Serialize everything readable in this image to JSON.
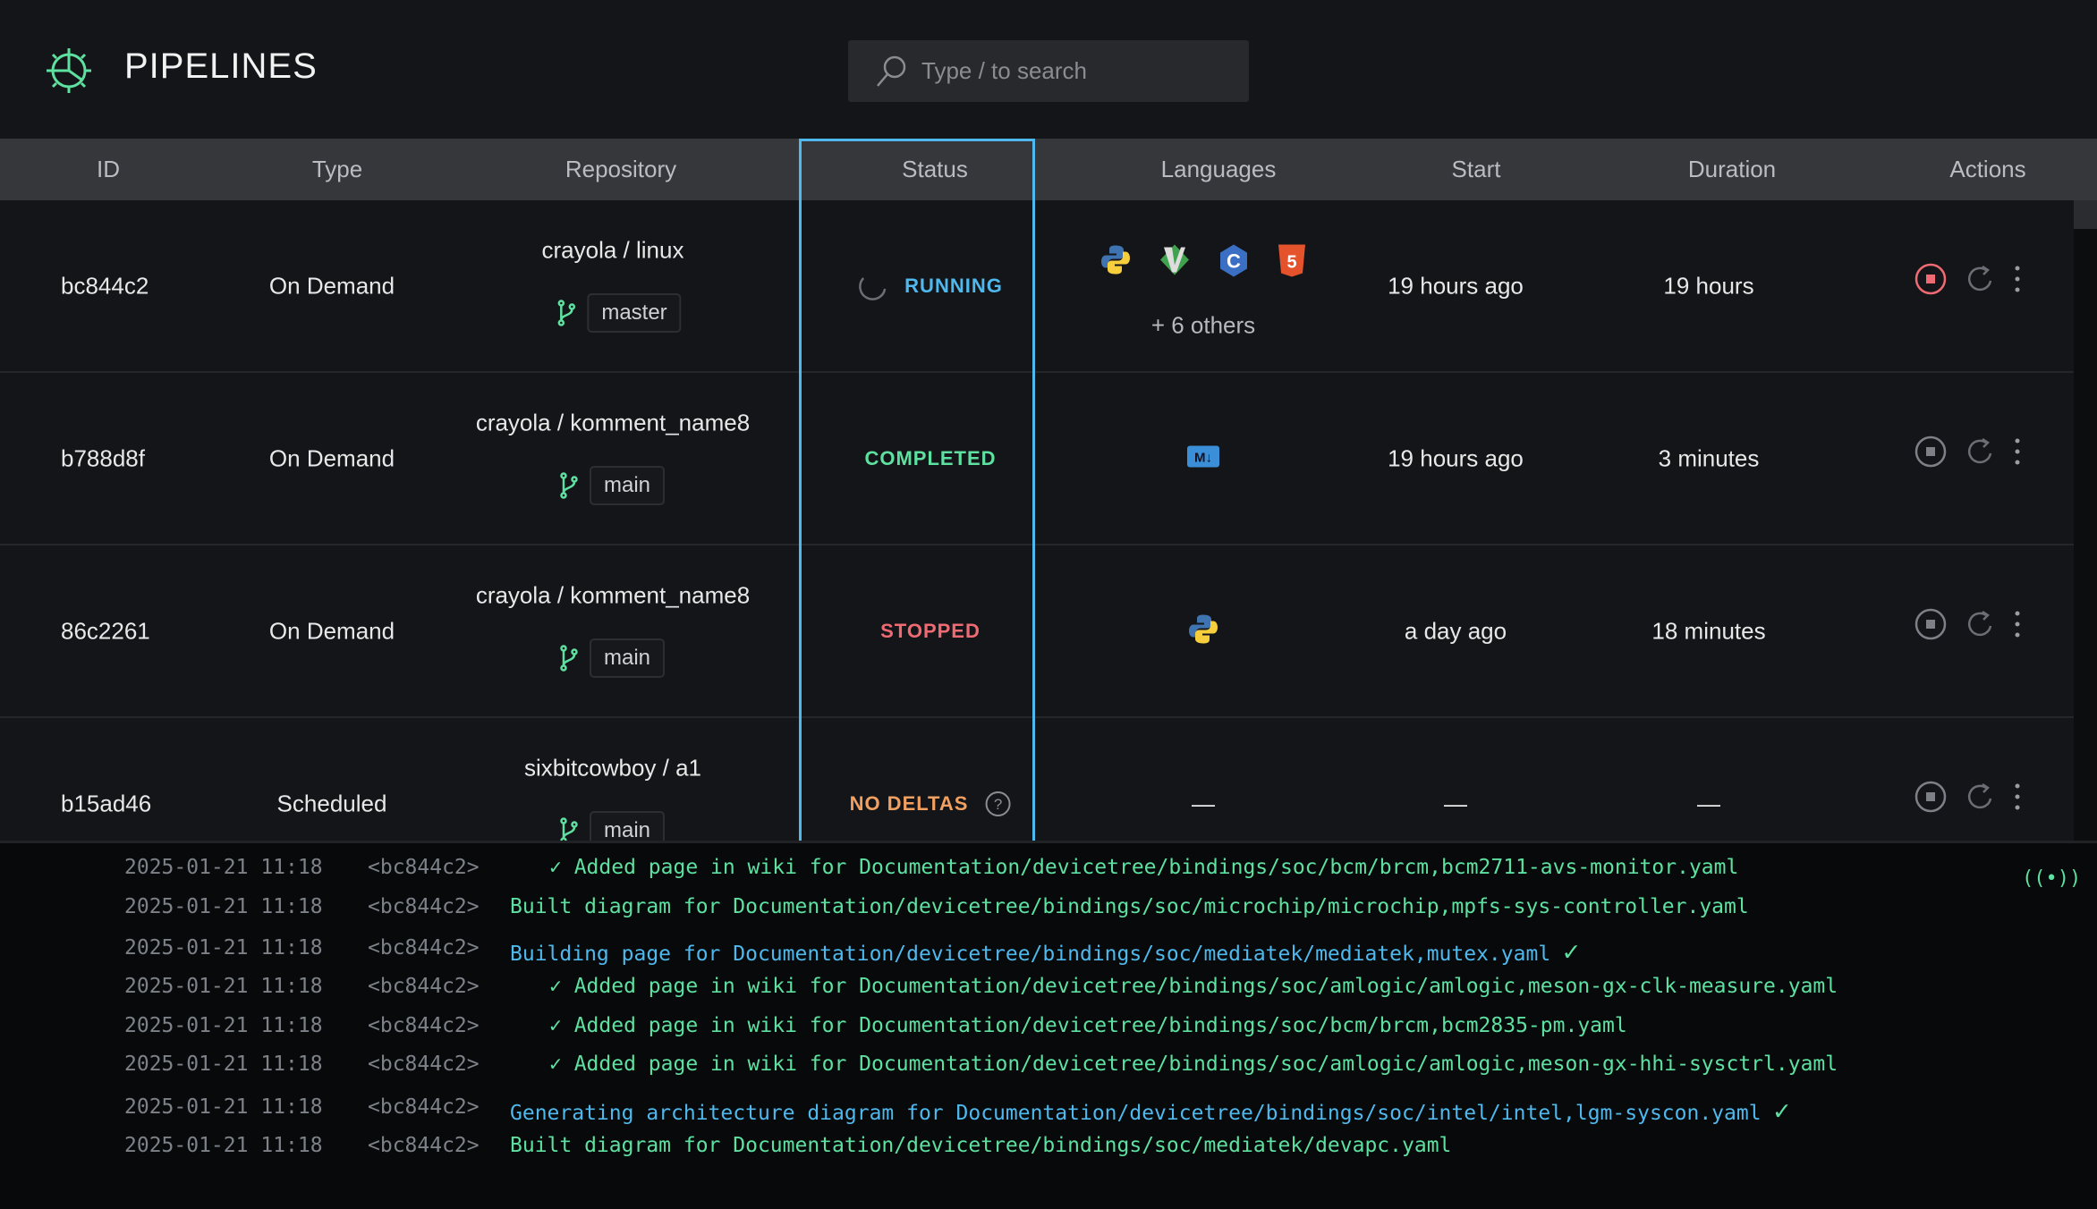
{
  "app": {
    "title": "PIPELINES",
    "search_placeholder": "Type / to search"
  },
  "colors": {
    "accent": "#5ee0a0",
    "running": "#4fb8ec",
    "completed": "#5ee0a0",
    "stopped": "#ef6b73",
    "no_deltas": "#f0a060",
    "highlight": "#4fb8ec"
  },
  "columns": [
    "ID",
    "Type",
    "Repository",
    "Status",
    "Languages",
    "Start",
    "Duration",
    "Actions"
  ],
  "rows": [
    {
      "id": "bc844c2",
      "type": "On Demand",
      "repo": "crayola / linux",
      "branch": "master",
      "status": "RUNNING",
      "languages": [
        "python",
        "vim",
        "c",
        "html5"
      ],
      "others": "+ 6 others",
      "start": "19 hours ago",
      "duration": "19 hours",
      "stop_active": true
    },
    {
      "id": "b788d8f",
      "type": "On Demand",
      "repo": "crayola / komment_name8",
      "branch": "main",
      "status": "COMPLETED",
      "languages": [
        "markdown"
      ],
      "start": "19 hours ago",
      "duration": "3 minutes",
      "stop_active": false
    },
    {
      "id": "86c2261",
      "type": "On Demand",
      "repo": "crayola / komment_name8",
      "branch": "main",
      "status": "STOPPED",
      "languages": [
        "python"
      ],
      "start": "a day ago",
      "duration": "18 minutes",
      "stop_active": false
    },
    {
      "id": "b15ad46",
      "type": "Scheduled",
      "repo": "sixbitcowboy / a1",
      "branch": "main",
      "status": "NO DELTAS",
      "languages": "—",
      "start": "—",
      "duration": "—",
      "stop_active": false
    }
  ],
  "logs": [
    {
      "ts": "2025-01-21 11:18",
      "id": "<bc844c2>",
      "kind": "added",
      "msg": "✓ Added page in wiki for Documentation/devicetree/bindings/soc/bcm/brcm,bcm2711-avs-monitor.yaml"
    },
    {
      "ts": "2025-01-21 11:18",
      "id": "<bc844c2>",
      "kind": "built",
      "msg": "Built diagram for Documentation/devicetree/bindings/soc/microchip/microchip,mpfs-sys-controller.yaml"
    },
    {
      "ts": "2025-01-21 11:18",
      "id": "<bc844c2>",
      "kind": "progress",
      "msg": "Building page for Documentation/devicetree/bindings/soc/mediatek/mediatek,mutex.yaml",
      "tick": "✓"
    },
    {
      "ts": "2025-01-21 11:18",
      "id": "<bc844c2>",
      "kind": "added",
      "msg": "✓ Added page in wiki for Documentation/devicetree/bindings/soc/amlogic/amlogic,meson-gx-clk-measure.yaml"
    },
    {
      "ts": "2025-01-21 11:18",
      "id": "<bc844c2>",
      "kind": "added",
      "msg": "✓ Added page in wiki for Documentation/devicetree/bindings/soc/bcm/brcm,bcm2835-pm.yaml"
    },
    {
      "ts": "2025-01-21 11:18",
      "id": "<bc844c2>",
      "kind": "added",
      "msg": "✓ Added page in wiki for Documentation/devicetree/bindings/soc/amlogic/amlogic,meson-gx-hhi-sysctrl.yaml"
    },
    {
      "ts": "2025-01-21 11:18",
      "id": "<bc844c2>",
      "kind": "progress",
      "msg": "Generating architecture diagram for Documentation/devicetree/bindings/soc/intel/intel,lgm-syscon.yaml",
      "tick": "✓"
    },
    {
      "ts": "2025-01-21 11:18",
      "id": "<bc844c2>",
      "kind": "built",
      "msg": "Built diagram for Documentation/devicetree/bindings/soc/mediatek/devapc.yaml"
    }
  ],
  "live_icon": "broadcast-icon"
}
